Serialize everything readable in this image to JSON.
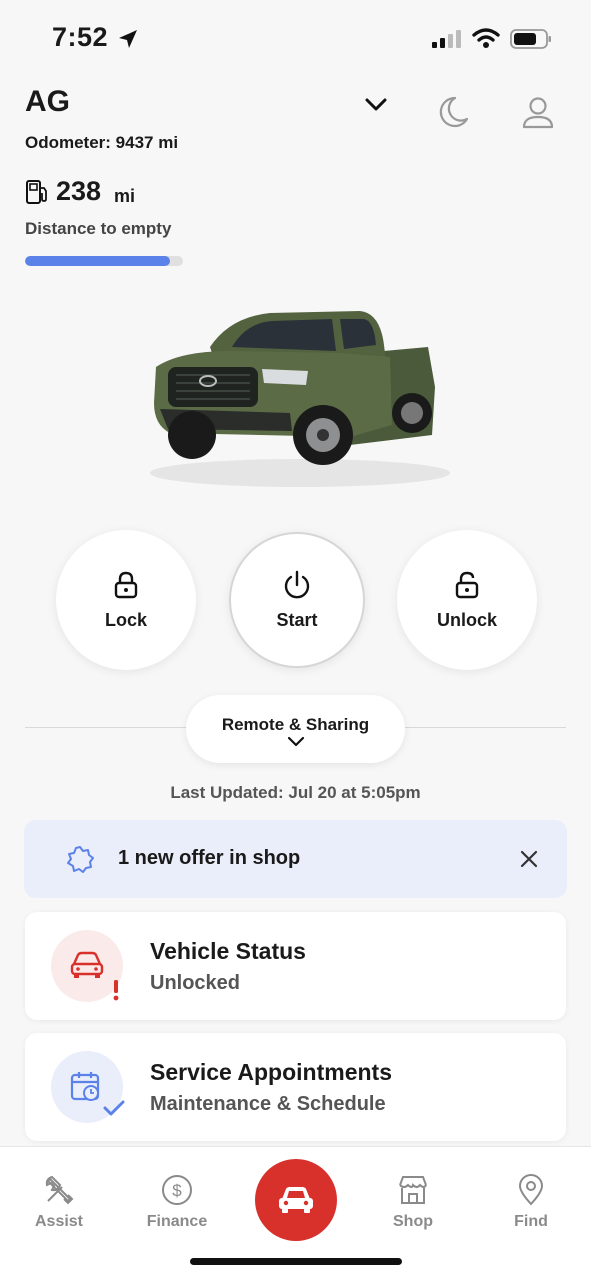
{
  "status_bar": {
    "time": "7:52",
    "battery_level": 0.65
  },
  "header": {
    "vehicle_name": "AG",
    "odometer": "Odometer: 9437 mi",
    "range_value": "238",
    "range_unit": "mi",
    "range_label": "Distance to empty",
    "fuel_level": 0.92
  },
  "remote": {
    "lock_label": "Lock",
    "start_label": "Start",
    "unlock_label": "Unlock",
    "sharing_label": "Remote & Sharing",
    "last_updated": "Last Updated: Jul 20 at 5:05pm"
  },
  "offer": {
    "text": "1 new offer in shop",
    "accent": "#5b82e8"
  },
  "cards": [
    {
      "title": "Vehicle Status",
      "subtitle": "Unlocked",
      "icon": "car-alert-icon",
      "color": "#d8312b"
    },
    {
      "title": "Service Appointments",
      "subtitle": "Maintenance & Schedule",
      "icon": "calendar-check-icon",
      "color": "#5b82e8"
    }
  ],
  "nav": {
    "assist": "Assist",
    "finance": "Finance",
    "shop": "Shop",
    "find": "Find",
    "center_color": "#d8312b"
  }
}
